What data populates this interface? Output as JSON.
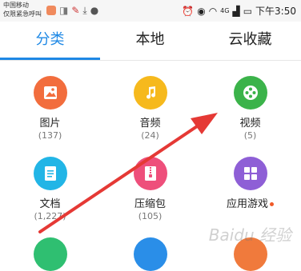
{
  "status_bar": {
    "carrier_line1": "中国移动",
    "carrier_line2": "仅限紧急呼叫",
    "time": "下午3:50",
    "network": "4G"
  },
  "tabs": [
    {
      "label": "分类",
      "active": true
    },
    {
      "label": "本地",
      "active": false
    },
    {
      "label": "云收藏",
      "active": false
    }
  ],
  "categories": [
    {
      "label": "图片",
      "count": "(137)",
      "icon": "image-icon",
      "color": "#f26d3d"
    },
    {
      "label": "音频",
      "count": "(24)",
      "icon": "music-note-icon",
      "color": "#f6b91d"
    },
    {
      "label": "视频",
      "count": "(5)",
      "icon": "film-reel-icon",
      "color": "#3bb34a"
    },
    {
      "label": "文档",
      "count": "(1,227)",
      "icon": "document-icon",
      "color": "#22b5e6"
    },
    {
      "label": "压缩包",
      "count": "(105)",
      "icon": "zip-icon",
      "color": "#ee4f7b"
    },
    {
      "label": "应用游戏",
      "count": "",
      "icon": "apps-grid-icon",
      "color": "#8e5fd6",
      "badge": true
    }
  ],
  "bottom_row_colors": [
    "#2fbf71",
    "#2a8ee8",
    "#f07a3c"
  ],
  "accent": "#1e88e5",
  "annotation_color": "#e53935",
  "watermark": "Baidu 经验"
}
